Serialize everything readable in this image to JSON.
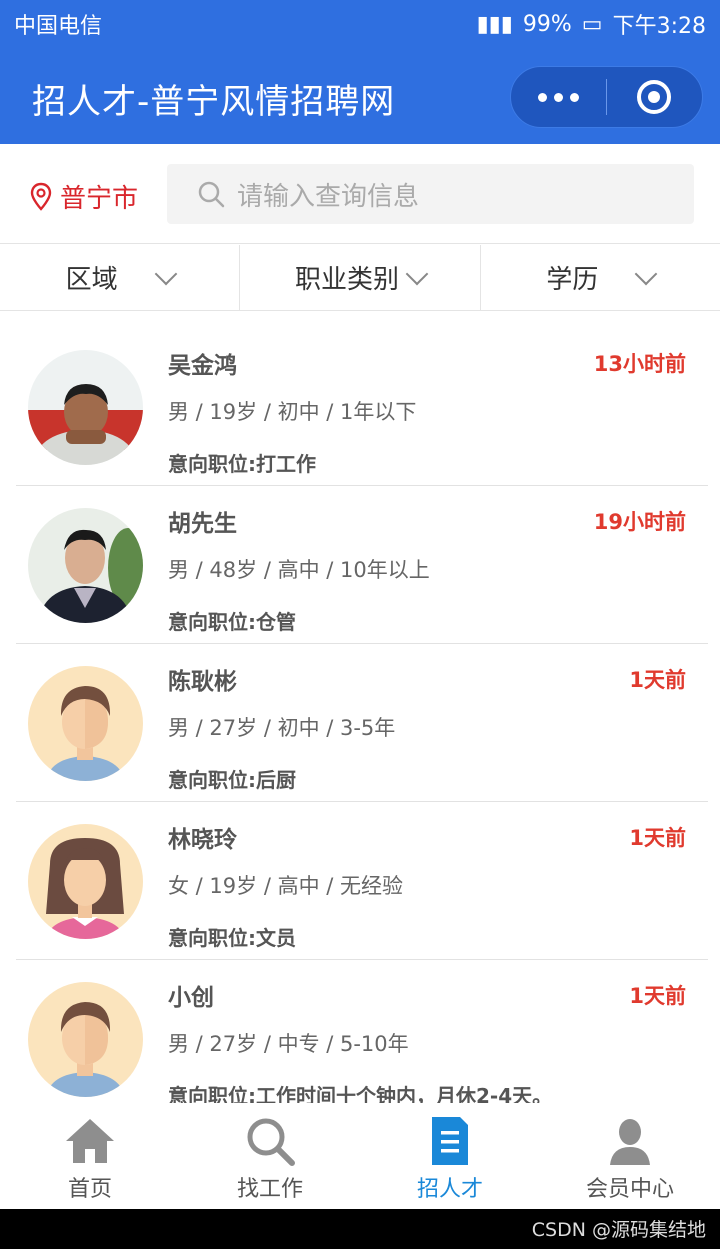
{
  "status": {
    "carrier": "中国电信",
    "battery": "99%",
    "time": "下午3:28"
  },
  "header": {
    "title": "招人才-普宁风情招聘网"
  },
  "search": {
    "city": "普宁市",
    "placeholder": "请输入查询信息"
  },
  "filters": [
    "区域",
    "职业类别",
    "学历"
  ],
  "talents": [
    {
      "name": "吴金鸿",
      "time": "13小时前",
      "info": "男 / 19岁 / 初中 / 1年以下",
      "job": "意向职位:打工作",
      "avatar": "photo-young-man"
    },
    {
      "name": "胡先生",
      "time": "19小时前",
      "info": "男 / 48岁 / 高中 / 10年以上",
      "job": "意向职位:仓管",
      "avatar": "photo-man-suit"
    },
    {
      "name": "陈耿彬",
      "time": "1天前",
      "info": "男 / 27岁 / 初中 / 3-5年",
      "job": "意向职位:后厨",
      "avatar": "male-default"
    },
    {
      "name": "林晓玲",
      "time": "1天前",
      "info": "女 / 19岁 / 高中 / 无经验",
      "job": "意向职位:文员",
      "avatar": "female-default"
    },
    {
      "name": "小创",
      "time": "1天前",
      "info": "男 / 27岁 / 中专 / 5-10年",
      "job": "意向职位:工作时间十个钟内，月休2-4天。",
      "avatar": "male-default"
    }
  ],
  "tabs": [
    {
      "label": "首页",
      "icon": "home-icon"
    },
    {
      "label": "找工作",
      "icon": "search-icon"
    },
    {
      "label": "招人才",
      "icon": "document-icon",
      "active": true
    },
    {
      "label": "会员中心",
      "icon": "user-icon"
    }
  ],
  "watermark": "CSDN @源码集结地",
  "colors": {
    "brand": "#2f6fe0",
    "time_red": "#e03a2e",
    "tab_active": "#1a88d8"
  }
}
